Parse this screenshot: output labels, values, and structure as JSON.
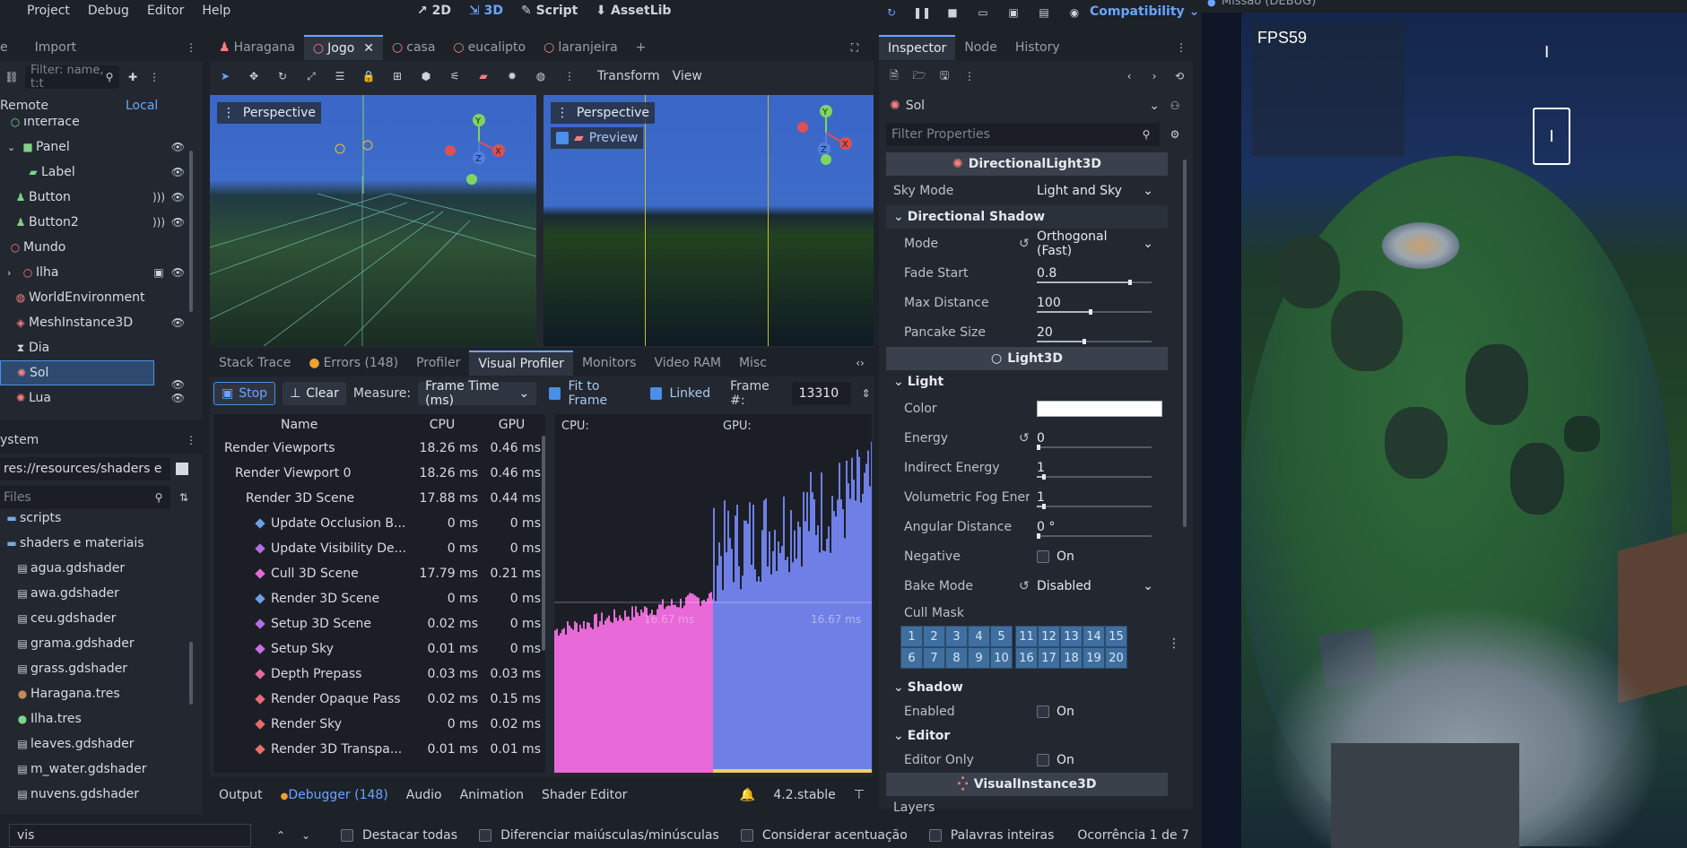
{
  "topbar": {
    "menus": [
      "Project",
      "Debug",
      "Editor",
      "Help"
    ],
    "modes": [
      "2D",
      "3D",
      "Script",
      "AssetLib"
    ],
    "renderer": "Compatibility"
  },
  "game_window": {
    "title": "Missão (DEBUG)",
    "fps": "FPS59"
  },
  "scene_dock": {
    "tabs": [
      "e",
      "Import"
    ],
    "filter_placeholder": "Filter: name, t:t",
    "remote": "Remote",
    "local": "Local",
    "items": [
      {
        "label": "Interface"
      },
      {
        "label": "Panel"
      },
      {
        "label": "Label"
      },
      {
        "label": "Button"
      },
      {
        "label": "Button2"
      },
      {
        "label": "Mundo"
      },
      {
        "label": "Ilha"
      },
      {
        "label": "WorldEnvironment"
      },
      {
        "label": "MeshInstance3D"
      },
      {
        "label": "Dia"
      },
      {
        "label": "Sol"
      },
      {
        "label": "Lua"
      }
    ]
  },
  "filesystem": {
    "title": "ystem",
    "path": "res://resources/shaders e",
    "filter_placeholder": "Files",
    "items": [
      {
        "label": "scripts"
      },
      {
        "label": "shaders e materiais"
      },
      {
        "label": "agua.gdshader"
      },
      {
        "label": "awa.gdshader"
      },
      {
        "label": "ceu.gdshader"
      },
      {
        "label": "grama.gdshader"
      },
      {
        "label": "grass.gdshader"
      },
      {
        "label": "Haragana.tres"
      },
      {
        "label": "Ilha.tres"
      },
      {
        "label": "leaves.gdshader"
      },
      {
        "label": "m_water.gdshader"
      },
      {
        "label": "nuvens.gdshader"
      }
    ]
  },
  "editor_tabs": [
    "Haragana",
    "Jogo",
    "casa",
    "eucalipto",
    "laranjeira"
  ],
  "viewport_toolbar": {
    "transform": "Transform",
    "view": "View"
  },
  "viewports": {
    "left_label": "Perspective",
    "right_label": "Perspective",
    "preview": "Preview"
  },
  "debugger": {
    "tabs": [
      "Stack Trace",
      "Errors (148)",
      "Profiler",
      "Visual Profiler",
      "Monitors",
      "Video RAM",
      "Misc"
    ],
    "stop": "Stop",
    "clear": "Clear",
    "measure_label": "Measure:",
    "measure_value": "Frame Time (ms)",
    "fit_to_frame": "Fit to Frame",
    "linked": "Linked",
    "frame_label": "Frame #:",
    "frame_value": "13310",
    "headers": {
      "name": "Name",
      "cpu": "CPU",
      "gpu": "GPU"
    },
    "rows": [
      {
        "name": "Render Viewports",
        "cpu": "18.26 ms",
        "gpu": "0.46 ms"
      },
      {
        "name": "Render Viewport 0",
        "cpu": "18.26 ms",
        "gpu": "0.46 ms"
      },
      {
        "name": "Render 3D Scene",
        "cpu": "17.88 ms",
        "gpu": "0.44 ms"
      },
      {
        "name": "Update Occlusion B...",
        "cpu": "0 ms",
        "gpu": "0 ms"
      },
      {
        "name": "Update Visibility De...",
        "cpu": "0 ms",
        "gpu": "0 ms"
      },
      {
        "name": "Cull 3D Scene",
        "cpu": "17.79 ms",
        "gpu": "0.21 ms"
      },
      {
        "name": "Render 3D Scene",
        "cpu": "0 ms",
        "gpu": "0 ms"
      },
      {
        "name": "Setup 3D Scene",
        "cpu": "0.02 ms",
        "gpu": "0 ms"
      },
      {
        "name": "Setup Sky",
        "cpu": "0.01 ms",
        "gpu": "0 ms"
      },
      {
        "name": "Depth Prepass",
        "cpu": "0.03 ms",
        "gpu": "0.03 ms"
      },
      {
        "name": "Render Opaque Pass",
        "cpu": "0.02 ms",
        "gpu": "0.15 ms"
      },
      {
        "name": "Render Sky",
        "cpu": "0 ms",
        "gpu": "0.02 ms"
      },
      {
        "name": "Render 3D Transpa...",
        "cpu": "0.01 ms",
        "gpu": "0.01 ms"
      }
    ],
    "graph": {
      "cpu_label": "CPU:",
      "gpu_label": "GPU:",
      "cpu_ms": "16.67 ms",
      "gpu_ms": "16.67 ms"
    }
  },
  "bottom_tabs": [
    "Output",
    "Debugger (148)",
    "Audio",
    "Animation",
    "Shader Editor"
  ],
  "version": "4.2.stable",
  "inspector": {
    "tabs": [
      "Inspector",
      "Node",
      "History"
    ],
    "node": "Sol",
    "filter_placeholder": "Filter Properties",
    "class_dl": "DirectionalLight3D",
    "sky_mode_label": "Sky Mode",
    "sky_mode": "Light and Sky",
    "section_shadow": "Directional Shadow",
    "mode_label": "Mode",
    "mode": "Orthogonal (Fast)",
    "fade_start_label": "Fade Start",
    "fade_start": "0.8",
    "max_distance_label": "Max Distance",
    "max_distance": "100",
    "pancake_label": "Pancake Size",
    "pancake": "20",
    "class_light": "Light3D",
    "section_light": "Light",
    "color_label": "Color",
    "energy_label": "Energy",
    "energy": "0",
    "indirect_label": "Indirect Energy",
    "indirect": "1",
    "volfog_label": "Volumetric Fog Ener...",
    "volfog": "1",
    "angular_label": "Angular Distance",
    "angular": "0 °",
    "negative_label": "Negative",
    "on": "On",
    "bake_label": "Bake Mode",
    "bake": "Disabled",
    "cull_label": "Cull Mask",
    "cull_row1": [
      "1",
      "2",
      "3",
      "4",
      "5",
      "11",
      "12",
      "13",
      "14",
      "15"
    ],
    "cull_row2": [
      "6",
      "7",
      "8",
      "9",
      "10",
      "16",
      "17",
      "18",
      "19",
      "20"
    ],
    "section_shadow2": "Shadow",
    "enabled_label": "Enabled",
    "section_editor": "Editor",
    "editor_only_label": "Editor Only",
    "class_vi": "VisualInstance3D",
    "layers_label": "Layers"
  },
  "findbar": {
    "query": "vis",
    "opt1": "Destacar todas",
    "opt2": "Diferenciar maiúsculas/minúsculas",
    "opt3": "Considerar acentuação",
    "opt4": "Palavras inteiras",
    "count": "Ocorrência 1 de 7"
  },
  "colors": {
    "accent": "#4a8fe7",
    "cpu_graph": "#e86ad8",
    "gpu_graph": "#6f7fe6",
    "selected": "#2e4a6e"
  }
}
